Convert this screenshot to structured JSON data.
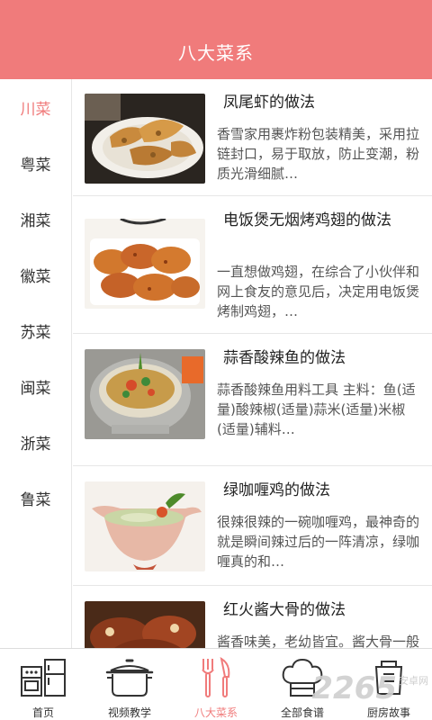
{
  "header": {
    "title": "八大菜系"
  },
  "sidebar": {
    "items": [
      {
        "label": "川菜",
        "active": true
      },
      {
        "label": "粤菜",
        "active": false
      },
      {
        "label": "湘菜",
        "active": false
      },
      {
        "label": "徽菜",
        "active": false
      },
      {
        "label": "苏菜",
        "active": false
      },
      {
        "label": "闽菜",
        "active": false
      },
      {
        "label": "浙菜",
        "active": false
      },
      {
        "label": "鲁菜",
        "active": false
      }
    ]
  },
  "recipes": [
    {
      "title": "凤尾虾的做法",
      "desc": "香雪家用裹炸粉包装精美，采用拉链封口，易于取放，防止变潮，粉质光滑细腻…"
    },
    {
      "title": "电饭煲无烟烤鸡翅的做法",
      "desc": "一直想做鸡翅，在综合了小伙伴和网上食友的意见后，决定用电饭煲烤制鸡翅，…"
    },
    {
      "title": "蒜香酸辣鱼的做法",
      "desc": "蒜香酸辣鱼用料工具 主料：鱼(适量)酸辣椒(适量)蒜米(适量)米椒(适量)辅料…"
    },
    {
      "title": "绿咖喱鸡的做法",
      "desc": "很辣很辣的一碗咖喱鸡，最神奇的就是瞬间辣过后的一阵清凉，绿咖喱真的和…"
    },
    {
      "title": "红火酱大骨的做法",
      "desc": "酱香味美，老幼皆宜。酱大骨一般都用猪脚骨，今儿用"
    }
  ],
  "tabbar": {
    "tabs": [
      {
        "label": "首页",
        "icon": "kitchen-icon"
      },
      {
        "label": "视频教学",
        "icon": "pot-icon"
      },
      {
        "label": "八大菜系",
        "icon": "utensils-icon",
        "active": true
      },
      {
        "label": "全部食谱",
        "icon": "chef-hat-icon"
      },
      {
        "label": "厨房故事",
        "icon": "story-icon"
      }
    ]
  },
  "watermark": {
    "text": "2265",
    "sub": "安卓网"
  },
  "colors": {
    "accent": "#f07b7b",
    "divider": "#e6e6e6"
  }
}
